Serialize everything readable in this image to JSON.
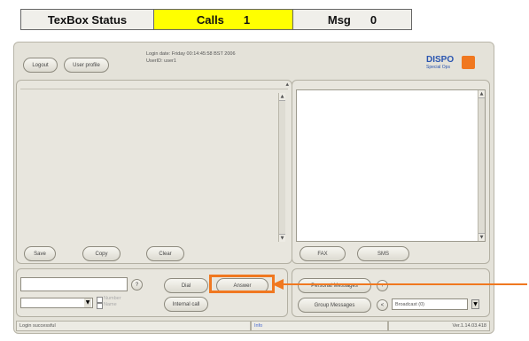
{
  "status_bar": {
    "title": "TexBox Status",
    "calls_label": "Calls",
    "calls_count": "1",
    "msg_label": "Msg",
    "msg_count": "0"
  },
  "header": {
    "logout_label": "Logout",
    "user_profile_label": "User profile",
    "login_date": "Login date: Friday 00:14:45:58 BST 2006",
    "user_id": "UserID: user1",
    "logo_text": "DISPO",
    "logo_sub": "Special Ops"
  },
  "left_panel": {
    "save_label": "Save",
    "copy_label": "Copy",
    "clear_label": "Clear"
  },
  "right_panel": {
    "fax_label": "FAX",
    "sms_label": "SMS"
  },
  "call_area": {
    "dial_label": "Dial",
    "answer_label": "Answer",
    "internal_call_label": "Internal call",
    "question_label": "?",
    "opt1_label": "Number",
    "opt2_label": "Name"
  },
  "message_area": {
    "personal_label": "Personal Messages",
    "group_label": "Group Messages",
    "plus_label": "+",
    "back_label": "<",
    "select_value": "Broadcast (0)"
  },
  "bottom_status": {
    "left": "Login successful",
    "middle": "Info",
    "right": "Ver.1.14.03.418"
  },
  "colors": {
    "calls_bg": "#ffff00",
    "highlight": "#f07820"
  }
}
